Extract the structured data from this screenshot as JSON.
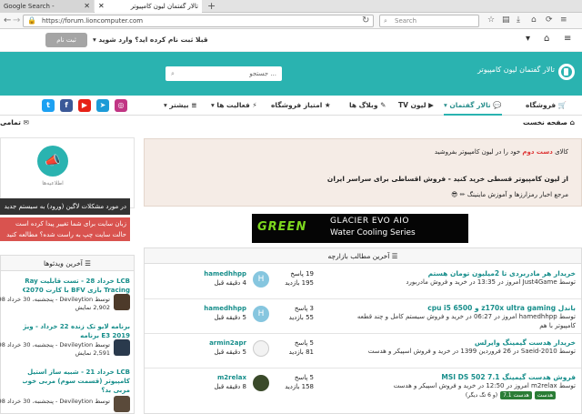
{
  "browser": {
    "tabs": [
      {
        "label": "Google Search -"
      },
      {
        "label": "تالار گفتمان لیون کامپیوتر"
      }
    ],
    "url": "https://forum.lioncomputer.com",
    "search_placeholder": "Search"
  },
  "topbar": {
    "register_button": "ثبت نام",
    "login_link": "قبلا ثبت نام کرده اید؟ وارد شوید"
  },
  "header": {
    "logo_text": "تالار گفتمان لیون کامپیوتر",
    "search_placeholder": "جستجو ..."
  },
  "nav": {
    "items": [
      {
        "label": "فروشگاه"
      },
      {
        "label": "تالار گفتمان"
      },
      {
        "label": "لیون TV"
      },
      {
        "label": "وبلاگ ها"
      },
      {
        "label": "امتیاز فروشگاه"
      },
      {
        "label": "فعالیت ها"
      },
      {
        "label": "بیشتر"
      }
    ]
  },
  "breadcrumb": {
    "home": "صفحه نخست",
    "all": "تمامی"
  },
  "announcement": {
    "line1_prefix": "کالای",
    "line1_highlight": "دست دوم",
    "line1_suffix": "خود را در لیون کامپیوتر بفروشید",
    "line2": "از لیون کامپیوتر قسطی خرید کنید - فروش اقساطی برای سراسر ایران",
    "line3": "مرجع اخبار رمزارزها و آموزش ماینینگ"
  },
  "banner": {
    "brand": "GREEN",
    "title": "GLACIER EVO AIO",
    "subtitle": "Water Cooling Series"
  },
  "latest": {
    "heading": "آخرین مطالب بازارچه",
    "rows": [
      {
        "title": "خریدار هر مادربردی تا 2میلیون تومان هستم",
        "meta": "توسط Just4Game امروز در 13:35 در خرید و فروش مادربورد",
        "meta2": "",
        "replies": "19 پاسخ",
        "views": "195 بازدید",
        "avatar": "H",
        "last_user": "hamedhhpp",
        "last_time": "4 دقیقه قبل",
        "color": "#86c6df"
      },
      {
        "title": "باندل z170x ultra gaming و cpu i5 6500",
        "meta": "توسط hamedhhpp امروز در 06:27 در خرید و فروش سیستم کامل و چند قطعه",
        "meta2": "کامپیوتر با هم",
        "replies": "3 پاسخ",
        "views": "55 بازدید",
        "avatar": "H",
        "last_user": "hamedhhpp",
        "last_time": "5 دقیقه قبل",
        "color": "#86c6df"
      },
      {
        "title": "خریدار هدست گیمینگ وایرلس",
        "meta": "توسط Saeid-2010 در 26 فروردین 1399 در خرید و فروش اسپیکر و هدست",
        "meta2": "",
        "replies": "5 پاسخ",
        "views": "81 بازدید",
        "avatar": "",
        "last_user": "armin2apr",
        "last_time": "5 دقیقه قبل",
        "color": "#f2f2f2"
      },
      {
        "title": "فروش هدست گیمینگ MSI DS 502 7.1",
        "meta": "توسط m2relax امروز در 12:50 در خرید و فروش اسپیکر و هدست",
        "meta2": "",
        "tags": [
          "هدست",
          "هدست 7.1"
        ],
        "tags_more": "(و 6 تگ دیگر)",
        "replies": "5 پاسخ",
        "views": "158 بازدید",
        "avatar": "",
        "last_user": "m2relax",
        "last_time": "8 دقیقه قبل",
        "color": "#3a4a2a"
      }
    ]
  },
  "sidebar": {
    "notifications_label": "اطلاعیه‌ها",
    "dark_notice": "در مورد مشکلات لاگین (ورود) به سیستم جدید",
    "red_notice_1": "زبان سایت برای شما تغییر پیدا کرده است",
    "red_notice_2": "حالت سایت چپ به راست شده؟ مطالعه کنید",
    "videos_heading": "آخرین ویدئوها",
    "videos": [
      {
        "title": "LCB خرداد 28 - تست قابلیت Ray",
        "title2": "Tracing بازی BFV با کارت RTX2070",
        "meta": "توسط Devileytion - پنجشنبه، 30 خرداد 98",
        "meta2": "2,902 نمایش"
      },
      {
        "title": "برنامه لایو تک زنده 22 خرداد - ویژه",
        "title2": "E3 2019 برنامه",
        "meta": "توسط Devileytion - پنجشنبه، 30 خرداد 98",
        "meta2": "2,591 نمایش"
      },
      {
        "title": "LCB خرداد 21 - شبیه ساز استیل",
        "title2": "کامپیوتر (قسمت سوم) مربی خوب یا",
        "title3": "مربی بد؟",
        "meta": "توسط Devileytion - پنجشنبه، 30 خرداد 98",
        "meta2": ""
      }
    ]
  }
}
